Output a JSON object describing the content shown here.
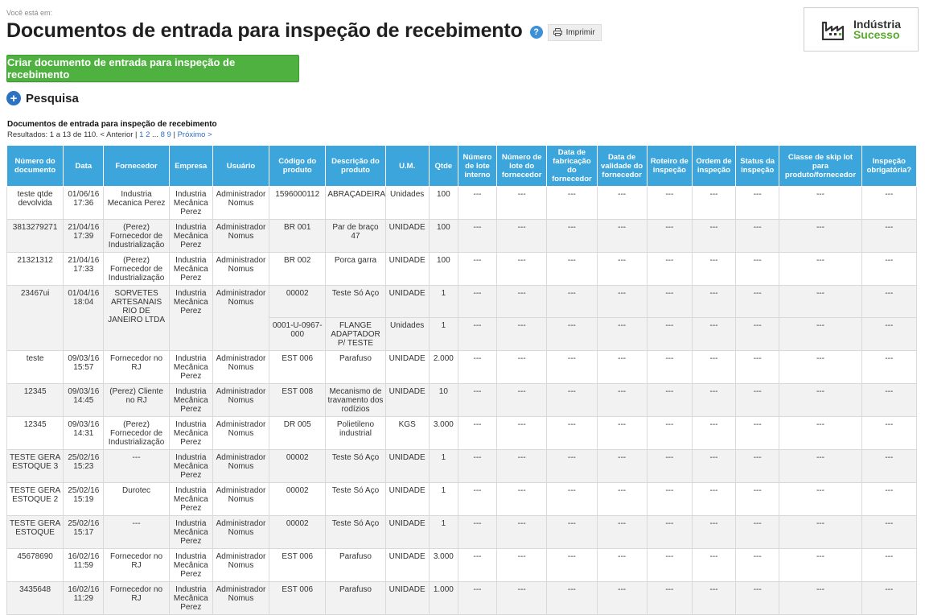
{
  "breadcrumb": "Você está em:",
  "page_title": "Documentos de entrada para inspeção de recebimento",
  "help_label": "?",
  "print_label": "Imprimir",
  "logo": {
    "line1": "Indústria",
    "line2": "Sucesso"
  },
  "create_button": "Criar documento de entrada para inspeção de recebimento",
  "search_label": "Pesquisa",
  "table_title": "Documentos de entrada para inspeção de recebimento",
  "pagination": {
    "results_text": "Resultados: 1 a 13 de 110. < Anterior | ",
    "page1": "1",
    "page2": "2",
    "ellipsis": "...",
    "page8": "8",
    "page9": "9",
    "sep": " | ",
    "next": "Próximo >"
  },
  "columns": [
    "Número do documento",
    "Data",
    "Fornecedor",
    "Empresa",
    "Usuário",
    "Código do produto",
    "Descrição do produto",
    "U.M.",
    "Qtde",
    "Número de lote interno",
    "Número de lote do fornecedor",
    "Data de fabricação do fornecedor",
    "Data de validade do fornecedor",
    "Roteiro de inspeção",
    "Ordem de inspeção",
    "Status da inspeção",
    "Classe de skip lot para produto/fornecedor",
    "Inspeção obrigatória?"
  ],
  "rows": [
    [
      "teste qtde devolvida",
      "01/06/16 17:36",
      "Industria Mecanica Perez",
      "Industria Mecânica Perez",
      "Administrador Nomus",
      "1596000112",
      "ABRAÇADEIRA",
      "Unidades",
      "100",
      "---",
      "---",
      "---",
      "---",
      "---",
      "---",
      "---",
      "---",
      "---"
    ],
    [
      "3813279271",
      "21/04/16 17:39",
      "(Perez) Fornecedor de Industrialização",
      "Industria Mecânica Perez",
      "Administrador Nomus",
      "BR 001",
      "Par de braço 47",
      "UNIDADE",
      "100",
      "---",
      "---",
      "---",
      "---",
      "---",
      "---",
      "---",
      "---",
      "---"
    ],
    [
      "21321312",
      "21/04/16 17:33",
      "(Perez) Fornecedor de Industrialização",
      "Industria Mecânica Perez",
      "Administrador Nomus",
      "BR 002",
      "Porca garra",
      "UNIDADE",
      "100",
      "---",
      "---",
      "---",
      "---",
      "---",
      "---",
      "---",
      "---",
      "---"
    ],
    [
      "23467ui",
      "01/04/16 18:04",
      "SORVETES ARTESANAIS RIO DE JANEIRO LTDA",
      "Industria Mecânica Perez",
      "Administrador Nomus",
      "00002",
      "Teste Só Aço",
      "UNIDADE",
      "1",
      "---",
      "---",
      "---",
      "---",
      "---",
      "---",
      "---",
      "---",
      "---"
    ],
    [
      "0001-U-0967-000",
      "FLANGE ADAPTADOR P/ TESTE",
      "Unidades",
      "1",
      "---",
      "---",
      "---",
      "---",
      "---",
      "---",
      "---",
      "---",
      "---"
    ],
    [
      "teste",
      "09/03/16 15:57",
      "Fornecedor no RJ",
      "Industria Mecânica Perez",
      "Administrador Nomus",
      "EST 006",
      "Parafuso",
      "UNIDADE",
      "2.000",
      "---",
      "---",
      "---",
      "---",
      "---",
      "---",
      "---",
      "---",
      "---"
    ],
    [
      "12345",
      "09/03/16 14:45",
      "(Perez) Cliente no RJ",
      "Industria Mecânica Perez",
      "Administrador Nomus",
      "EST 008",
      "Mecanismo de travamento dos rodízios",
      "UNIDADE",
      "10",
      "---",
      "---",
      "---",
      "---",
      "---",
      "---",
      "---",
      "---",
      "---"
    ],
    [
      "12345",
      "09/03/16 14:31",
      "(Perez) Fornecedor de Industrialização",
      "Industria Mecânica Perez",
      "Administrador Nomus",
      "DR 005",
      "Polietileno industrial",
      "KGS",
      "3.000",
      "---",
      "---",
      "---",
      "---",
      "---",
      "---",
      "---",
      "---",
      "---"
    ],
    [
      "TESTE GERA ESTOQUE 3",
      "25/02/16 15:23",
      "---",
      "Industria Mecânica Perez",
      "Administrador Nomus",
      "00002",
      "Teste Só Aço",
      "UNIDADE",
      "1",
      "---",
      "---",
      "---",
      "---",
      "---",
      "---",
      "---",
      "---",
      "---"
    ],
    [
      "TESTE GERA ESTOQUE 2",
      "25/02/16 15:19",
      "Durotec",
      "Industria Mecânica Perez",
      "Administrador Nomus",
      "00002",
      "Teste Só Aço",
      "UNIDADE",
      "1",
      "---",
      "---",
      "---",
      "---",
      "---",
      "---",
      "---",
      "---",
      "---"
    ],
    [
      "TESTE GERA ESTOQUE",
      "25/02/16 15:17",
      "---",
      "Industria Mecânica Perez",
      "Administrador Nomus",
      "00002",
      "Teste Só Aço",
      "UNIDADE",
      "1",
      "---",
      "---",
      "---",
      "---",
      "---",
      "---",
      "---",
      "---",
      "---"
    ],
    [
      "45678690",
      "16/02/16 11:59",
      "Fornecedor no RJ",
      "Industria Mecânica Perez",
      "Administrador Nomus",
      "EST 006",
      "Parafuso",
      "UNIDADE",
      "3.000",
      "---",
      "---",
      "---",
      "---",
      "---",
      "---",
      "---",
      "---",
      "---"
    ],
    [
      "3435648",
      "16/02/16 11:29",
      "Fornecedor no RJ",
      "Industria Mecânica Perez",
      "Administrador Nomus",
      "EST 006",
      "Parafuso",
      "UNIDADE",
      "1.000",
      "---",
      "---",
      "---",
      "---",
      "---",
      "---",
      "---",
      "---",
      "---"
    ]
  ]
}
